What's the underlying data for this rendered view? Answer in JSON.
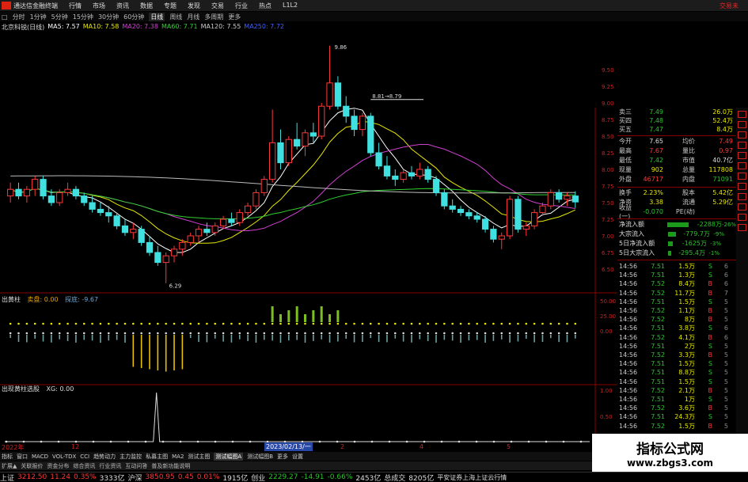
{
  "titlebar": {
    "app_title": "通达信金融终端",
    "menu": [
      "行情",
      "市场",
      "资讯",
      "数据",
      "专题",
      "发现",
      "交易",
      "行业",
      "热点",
      "L1L2"
    ],
    "right_text": "交易未"
  },
  "periodbar": {
    "items": [
      "□",
      "分时",
      "1分钟",
      "5分钟",
      "15分钟",
      "30分钟",
      "60分钟",
      "日线",
      "周线",
      "月线",
      "多周期",
      "更多"
    ],
    "active": "日线"
  },
  "legend": {
    "name": "北京科锐(日线)",
    "ma5": "MA5: 7.57",
    "ma10": "MA10: 7.58",
    "ma20": "MA20: 7.38",
    "ma60": "MA60: 7.71",
    "ma120": "MA120: 7.55",
    "ma250": "MA250: 7.72"
  },
  "main_annotations": {
    "high": "9.86",
    "low": "6.29",
    "line_label": "8.81→8.79"
  },
  "price_axis": [
    "9.50",
    "9.25",
    "9.00",
    "8.75",
    "8.50",
    "8.25",
    "8.00",
    "7.75",
    "7.50",
    "7.25",
    "7.00",
    "6.75",
    "6.50"
  ],
  "quote": {
    "asks": [
      {
        "l": "卖三",
        "v": "7.49",
        "v2": "26.0万"
      },
      {
        "l": "买四",
        "v": "7.48",
        "v2": "52.4万"
      },
      {
        "l": "买五",
        "v": "7.47",
        "v2": "8.4万"
      }
    ],
    "stats": [
      {
        "l": "今开",
        "v": "7.65",
        "l2": "均价",
        "v2": "7.49"
      },
      {
        "l": "最高",
        "v": "7.67",
        "l2": "量比",
        "v2": "0.97"
      },
      {
        "l": "最低",
        "v": "7.42",
        "l2": "市值",
        "v2": "40.7亿"
      },
      {
        "l": "现量",
        "v": "902",
        "l2": "总量",
        "v2": "117808"
      },
      {
        "l": "外盘",
        "v": "46717",
        "l2": "内盘",
        "v2": "71091"
      }
    ],
    "stats2": [
      {
        "l": "换手",
        "v": "2.23%",
        "l2": "股本",
        "v2": "5.42亿"
      },
      {
        "l": "净资",
        "v": "3.38",
        "l2": "流通",
        "v2": "5.29亿"
      },
      {
        "l": "收益(一)",
        "v": "-0.070",
        "l2": "PE(动)",
        "v2": ""
      }
    ]
  },
  "fund_flow": [
    {
      "label": "净流入额",
      "value": "-2288万",
      "pct": "-26%"
    },
    {
      "label": "大宗流入",
      "value": "-779.7万",
      "pct": "-9%"
    },
    {
      "label": "5日净流入额",
      "value": "-1625万",
      "pct": "-3%"
    },
    {
      "label": "5日大宗流入",
      "value": "-295.4万",
      "pct": "-1%"
    }
  ],
  "ticks": [
    {
      "t": "14:56",
      "p": "7.51",
      "v": "1.5万",
      "b": "S",
      "n": "6"
    },
    {
      "t": "14:56",
      "p": "7.51",
      "v": "1.3万",
      "b": "S",
      "n": "6"
    },
    {
      "t": "14:56",
      "p": "7.52",
      "v": "8.4万",
      "b": "B",
      "n": "6"
    },
    {
      "t": "14:56",
      "p": "7.52",
      "v": "11.7万",
      "b": "B",
      "n": "7"
    },
    {
      "t": "14:56",
      "p": "7.51",
      "v": "1.5万",
      "b": "S",
      "n": "5"
    },
    {
      "t": "14:56",
      "p": "7.52",
      "v": "1.1万",
      "b": "B",
      "n": "5"
    },
    {
      "t": "14:56",
      "p": "7.52",
      "v": "8万",
      "b": "B",
      "n": "5"
    },
    {
      "t": "14:56",
      "p": "7.51",
      "v": "3.8万",
      "b": "S",
      "n": "6"
    },
    {
      "t": "14:56",
      "p": "7.52",
      "v": "4.1万",
      "b": "B",
      "n": "6"
    },
    {
      "t": "14:56",
      "p": "7.51",
      "v": "2万",
      "b": "S",
      "n": "5"
    },
    {
      "t": "14:56",
      "p": "7.52",
      "v": "3.3万",
      "b": "B",
      "n": "5"
    },
    {
      "t": "14:56",
      "p": "7.51",
      "v": "1.5万",
      "b": "S",
      "n": "5"
    },
    {
      "t": "14:56",
      "p": "7.51",
      "v": "8.8万",
      "b": "S",
      "n": "5"
    },
    {
      "t": "14:56",
      "p": "7.51",
      "v": "1.5万",
      "b": "S",
      "n": "5"
    },
    {
      "t": "14:56",
      "p": "7.52",
      "v": "2.1万",
      "b": "B",
      "n": "5"
    },
    {
      "t": "14:56",
      "p": "7.51",
      "v": "1万",
      "b": "S",
      "n": "5"
    },
    {
      "t": "14:56",
      "p": "7.52",
      "v": "3.6万",
      "b": "B",
      "n": "5"
    },
    {
      "t": "14:56",
      "p": "7.51",
      "v": "24.3万",
      "b": "S",
      "n": "5"
    },
    {
      "t": "14:56",
      "p": "7.52",
      "v": "1.5万",
      "b": "B",
      "n": "5"
    }
  ],
  "pane1": {
    "title": "出黄柱",
    "val1": "卖盘: 0.00",
    "val2": "探底: -9.67",
    "axis": [
      "50.00",
      "25.00",
      "0.00"
    ]
  },
  "pane2": {
    "title": "出现黄柱选股",
    "val1": "XG: 0.00",
    "axis": [
      "1.00",
      "0.50",
      "0.00"
    ]
  },
  "time_axis": {
    "left": "2022年",
    "mid": "12",
    "date_box": "2023/02/13/一",
    "marks": [
      "2",
      "4",
      "5"
    ]
  },
  "tabs": {
    "items": [
      "指标",
      "窗口",
      "MACD",
      "VOL-TDX",
      "CCI",
      "趋势动力",
      "主力监控",
      "私募主图",
      "MA2",
      "测试主图",
      "测试幅图A",
      "测试幅图B",
      "更多",
      "设置"
    ],
    "active": "测试幅图A"
  },
  "submenu": {
    "items": [
      "扩展▲",
      "关联报价",
      "资金分布",
      "综合资讯",
      "行业资讯",
      "互动问答",
      "普及新功能说明"
    ]
  },
  "status": {
    "sh_name": "上证",
    "sh_val": "3212.50",
    "sh_chg": "11.24",
    "sh_pct": "0.35%",
    "sh_amt": "3333亿",
    "sz_name": "沪深",
    "sz_val": "3850.95",
    "sz_chg": "0.45",
    "sz_pct": "0.01%",
    "sz_amt": "1915亿",
    "cy_name": "创业",
    "cy_val": "2229.27",
    "cy_chg": "-14.91",
    "cy_pct": "-0.66%",
    "cy_amt": "2453亿",
    "total_label": "总成交",
    "total_val": "8205亿",
    "broker": "平安证券上海上证云行情"
  },
  "watermark": {
    "line1": "指标公式网",
    "line2": "www.zbgs3.com"
  },
  "chart_data": {
    "type": "candlestick",
    "title": "北京科锐(日线)",
    "ylim": [
      6.25,
      10.0
    ],
    "ohlc": [
      [
        7.6,
        7.8,
        7.5,
        7.7
      ],
      [
        7.7,
        7.8,
        7.55,
        7.6
      ],
      [
        7.6,
        7.75,
        7.5,
        7.7
      ],
      [
        7.7,
        7.9,
        7.6,
        7.85
      ],
      [
        7.85,
        7.9,
        7.55,
        7.6
      ],
      [
        7.6,
        7.7,
        7.45,
        7.5
      ],
      [
        7.5,
        7.7,
        7.45,
        7.65
      ],
      [
        7.65,
        7.8,
        7.6,
        7.7
      ],
      [
        7.7,
        7.75,
        7.55,
        7.6
      ],
      [
        7.6,
        7.65,
        7.45,
        7.5
      ],
      [
        7.5,
        7.6,
        7.35,
        7.4
      ],
      [
        7.4,
        7.5,
        7.3,
        7.35
      ],
      [
        7.35,
        7.45,
        7.2,
        7.3
      ],
      [
        7.3,
        7.35,
        7.1,
        7.15
      ],
      [
        7.15,
        7.25,
        7.0,
        7.05
      ],
      [
        7.05,
        7.2,
        6.95,
        7.1
      ],
      [
        7.1,
        7.15,
        6.85,
        6.9
      ],
      [
        6.9,
        7.0,
        6.7,
        6.75
      ],
      [
        6.75,
        6.85,
        6.55,
        6.6
      ],
      [
        6.6,
        6.75,
        6.29,
        6.7
      ],
      [
        6.7,
        6.85,
        6.6,
        6.8
      ],
      [
        6.8,
        6.95,
        6.7,
        6.9
      ],
      [
        6.9,
        7.05,
        6.85,
        7.0
      ],
      [
        7.0,
        7.15,
        6.9,
        7.1
      ],
      [
        7.1,
        7.2,
        7.0,
        7.05
      ],
      [
        7.05,
        7.2,
        7.0,
        7.15
      ],
      [
        7.15,
        7.3,
        7.1,
        7.25
      ],
      [
        7.25,
        7.35,
        7.15,
        7.2
      ],
      [
        7.2,
        7.4,
        7.15,
        7.35
      ],
      [
        7.35,
        7.5,
        7.3,
        7.45
      ],
      [
        7.45,
        7.7,
        7.4,
        7.65
      ],
      [
        7.65,
        7.9,
        7.6,
        7.85
      ],
      [
        7.85,
        8.9,
        7.8,
        8.4
      ],
      [
        8.4,
        8.6,
        8.0,
        8.1
      ],
      [
        8.1,
        8.5,
        8.05,
        8.45
      ],
      [
        8.45,
        8.7,
        8.3,
        8.35
      ],
      [
        8.35,
        8.6,
        8.2,
        8.55
      ],
      [
        8.55,
        8.7,
        8.4,
        8.5
      ],
      [
        8.5,
        9.0,
        8.45,
        8.95
      ],
      [
        8.95,
        9.86,
        8.9,
        9.3
      ],
      [
        9.3,
        9.4,
        8.9,
        8.95
      ],
      [
        8.95,
        9.1,
        8.7,
        8.8
      ],
      [
        8.8,
        8.9,
        8.5,
        8.6
      ],
      [
        8.6,
        8.85,
        8.5,
        8.8
      ],
      [
        8.8,
        8.85,
        8.2,
        8.25
      ],
      [
        8.25,
        8.4,
        8.0,
        8.05
      ],
      [
        8.05,
        8.2,
        7.85,
        7.9
      ],
      [
        7.9,
        8.0,
        7.75,
        7.85
      ],
      [
        7.85,
        8.0,
        7.8,
        7.95
      ],
      [
        7.95,
        8.05,
        7.85,
        7.9
      ],
      [
        7.9,
        8.1,
        7.85,
        8.0
      ],
      [
        8.0,
        8.05,
        7.8,
        7.85
      ],
      [
        7.85,
        7.9,
        7.6,
        7.65
      ],
      [
        7.65,
        7.7,
        7.4,
        7.45
      ],
      [
        7.45,
        7.55,
        7.35,
        7.4
      ],
      [
        7.4,
        7.45,
        7.3,
        7.35
      ],
      [
        7.35,
        7.4,
        7.25,
        7.3
      ],
      [
        7.3,
        7.35,
        7.2,
        7.25
      ],
      [
        7.25,
        7.3,
        7.05,
        7.1
      ],
      [
        7.1,
        7.15,
        6.9,
        6.95
      ],
      [
        6.95,
        7.05,
        6.8,
        7.0
      ],
      [
        7.0,
        7.6,
        6.95,
        7.55
      ],
      [
        7.55,
        7.6,
        7.05,
        7.1
      ],
      [
        7.1,
        7.2,
        7.0,
        7.15
      ],
      [
        7.15,
        7.4,
        7.1,
        7.35
      ],
      [
        7.35,
        7.5,
        7.3,
        7.45
      ],
      [
        7.45,
        7.7,
        7.4,
        7.65
      ],
      [
        7.65,
        7.7,
        7.5,
        7.55
      ],
      [
        7.55,
        7.65,
        7.45,
        7.6
      ],
      [
        7.6,
        7.67,
        7.42,
        7.51
      ]
    ]
  }
}
